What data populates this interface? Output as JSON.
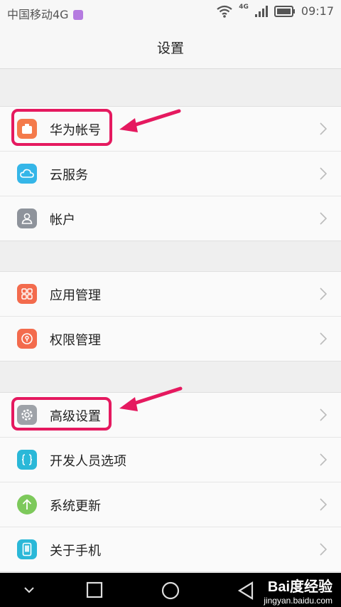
{
  "status_bar": {
    "carrier": "中国移动4G",
    "network": "4G",
    "time": "09:17"
  },
  "header": {
    "title": "设置"
  },
  "groups": [
    {
      "items": [
        {
          "label": "华为帐号",
          "icon": "huawei-account-icon",
          "color": "#f47a4b"
        },
        {
          "label": "云服务",
          "icon": "cloud-icon",
          "color": "#35b6e8"
        },
        {
          "label": "帐户",
          "icon": "user-icon",
          "color": "#8e939b"
        }
      ]
    },
    {
      "items": [
        {
          "label": "应用管理",
          "icon": "apps-grid-icon",
          "color": "#f36b4d"
        },
        {
          "label": "权限管理",
          "icon": "permission-icon",
          "color": "#f36b4d"
        }
      ]
    },
    {
      "items": [
        {
          "label": "高级设置",
          "icon": "gear-icon",
          "color": "#9ea2a8"
        },
        {
          "label": "开发人员选项",
          "icon": "braces-icon",
          "color": "#2ab8d8"
        },
        {
          "label": "系统更新",
          "icon": "arrow-up-icon",
          "color": "#7dc95b"
        },
        {
          "label": "关于手机",
          "icon": "phone-icon",
          "color": "#2ab8d8"
        }
      ]
    }
  ],
  "colors": {
    "highlight": "#e5195f"
  },
  "watermark": {
    "brand": "Bai度经验",
    "url": "jingyan.baidu.com"
  }
}
